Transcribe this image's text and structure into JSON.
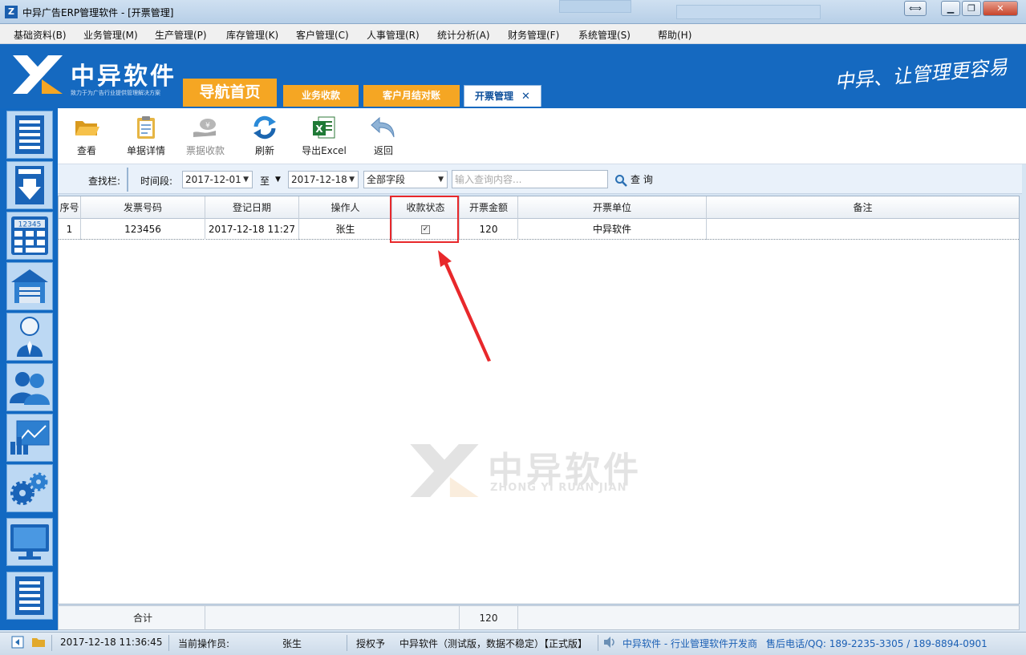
{
  "window": {
    "title": "中异广告ERP管理软件 - [开票管理]"
  },
  "menu": [
    "基础资料(B)",
    "业务管理(M)",
    "生产管理(P)",
    "库存管理(K)",
    "客户管理(C)",
    "人事管理(R)",
    "统计分析(A)",
    "财务管理(F)",
    "系统管理(S)",
    "帮助(H)"
  ],
  "banner": {
    "brand": "中异软件",
    "tagline": "致力于为广告行业提供管理解决方案",
    "slogan": "中异、让管理更容易"
  },
  "tabs": {
    "home": "导航首页",
    "items": [
      "业务收款",
      "客户月结对账",
      "开票管理"
    ],
    "close_glyph": "✕"
  },
  "toolbar": {
    "view": "查看",
    "details": "单据详情",
    "receive": "票据收款",
    "refresh": "刷新",
    "export": "导出Excel",
    "back": "返回"
  },
  "search": {
    "label": "查找栏:",
    "period_label": "时间段:",
    "date_from": "2017-12-01",
    "to": "至",
    "date_to": "2017-12-18",
    "field": "全部字段",
    "placeholder": "输入查询内容...",
    "query": "查 询"
  },
  "grid": {
    "columns": [
      "序号",
      "发票号码",
      "登记日期",
      "操作人",
      "收款状态",
      "开票金额",
      "开票单位",
      "备注"
    ],
    "rows": [
      {
        "index": "1",
        "invoice_no": "123456",
        "date": "2017-12-18 11:27",
        "operator": "张生",
        "paid": true,
        "amount": "120",
        "company": "中异软件",
        "remark": ""
      }
    ]
  },
  "footer": {
    "label": "合计",
    "amount_total": "120"
  },
  "watermark": {
    "text": "中异软件",
    "sub": "ZHONG YI RUAN JIAN"
  },
  "status": {
    "datetime": "2017-12-18 11:36:45",
    "operator_label": "当前操作员:",
    "operator": "张生",
    "license_label": "授权予",
    "license": "中异软件（测试版，数据不稳定）【正式版】",
    "vendor": "中异软件 - 行业管理软件开发商",
    "hotline": "售后电话/QQ: 189-2235-3305 / 189-8894-0901"
  },
  "colors": {
    "brand_blue": "#1569c0",
    "tab_orange": "#f5a623",
    "highlight_red": "#e8282b"
  }
}
